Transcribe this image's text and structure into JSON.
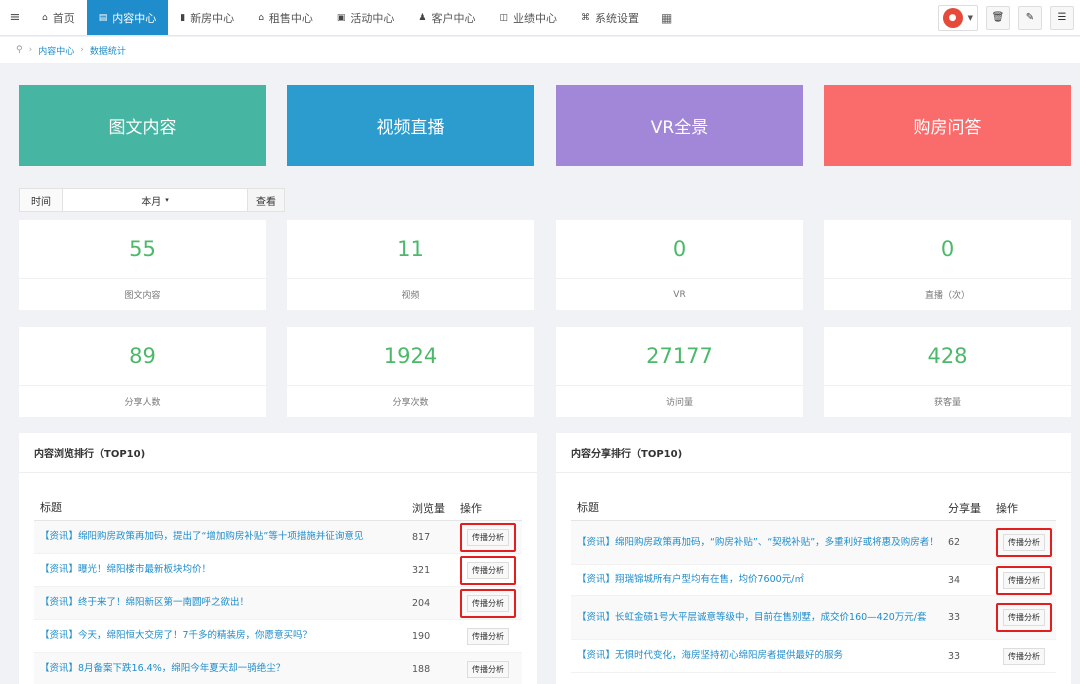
{
  "nav": {
    "items": [
      {
        "label": "首页",
        "icon": "home-icon",
        "glyph": "⌂"
      },
      {
        "label": "内容中心",
        "icon": "content-icon",
        "glyph": "▤",
        "active": true
      },
      {
        "label": "新房中心",
        "icon": "building-icon",
        "glyph": "▮"
      },
      {
        "label": "租售中心",
        "icon": "home-icon",
        "glyph": "⌂"
      },
      {
        "label": "活动中心",
        "icon": "calendar-icon",
        "glyph": "▣"
      },
      {
        "label": "客户中心",
        "icon": "user-add-icon",
        "glyph": "♟"
      },
      {
        "label": "业绩中心",
        "icon": "chart-icon",
        "glyph": "◫"
      },
      {
        "label": "系统设置",
        "icon": "settings-icon",
        "glyph": "⌘"
      }
    ],
    "active_color": "#1f8ccb"
  },
  "breadcrumb": {
    "items": [
      "内容中心",
      "数据统计"
    ]
  },
  "tiles": [
    {
      "label": "图文内容",
      "color": "#46b5a2"
    },
    {
      "label": "视频直播",
      "color": "#2c9ccf"
    },
    {
      "label": "VR全景",
      "color": "#a287d8"
    },
    {
      "label": "购房问答",
      "color": "#fa6b6b"
    }
  ],
  "filter": {
    "label": "时间",
    "value": "本月",
    "button": "查看"
  },
  "stats_row1": [
    {
      "value": "55",
      "label": "图文内容"
    },
    {
      "value": "11",
      "label": "视频"
    },
    {
      "value": "0",
      "label": "VR"
    },
    {
      "value": "0",
      "label": "直播（次）"
    }
  ],
  "stats_row2": [
    {
      "value": "89",
      "label": "分享人数"
    },
    {
      "value": "1924",
      "label": "分享次数"
    },
    {
      "value": "27177",
      "label": "访问量"
    },
    {
      "value": "428",
      "label": "获客量"
    }
  ],
  "browse_panel": {
    "title": "内容浏览排行（TOP10)",
    "headers": [
      "标题",
      "浏览量",
      "操作"
    ],
    "rows": [
      {
        "title": "【资讯】绵阳购房政策再加码，提出了“增加购房补贴”等十项措施并征询意见",
        "count": "817",
        "op": "传播分析",
        "highlight": true
      },
      {
        "title": "【资讯】曝光！绵阳楼市最新板块均价！",
        "count": "321",
        "op": "传播分析",
        "highlight": true
      },
      {
        "title": "【资讯】终于来了！绵阳新区第一南圆呼之欲出！",
        "count": "204",
        "op": "传播分析",
        "highlight": true
      },
      {
        "title": "【资讯】今天，绵阳恒大交房了！7千多的精装房，你愿意买吗？",
        "count": "190",
        "op": "传播分析",
        "highlight": false
      },
      {
        "title": "【资讯】8月备案下跌16.4%，绵阳今年夏天却一骑绝尘？",
        "count": "188",
        "op": "传播分析",
        "highlight": false
      }
    ]
  },
  "share_panel": {
    "title": "内容分享排行（TOP10)",
    "headers": [
      "标题",
      "分享量",
      "操作"
    ],
    "rows": [
      {
        "title": "【资讯】绵阳购房政策再加码，“购房补贴”、“契税补贴”，多重利好或将惠及购房者！",
        "count": "62",
        "op": "传播分析",
        "highlight": true
      },
      {
        "title": "【资讯】翔瑞锦城所有户型均有在售，均价7600元/㎡",
        "count": "34",
        "op": "传播分析",
        "highlight": true
      },
      {
        "title": "【资讯】长虹金碛1号大平层诚意等级中，目前在售别墅，成交价160—420万元/套",
        "count": "33",
        "op": "传播分析",
        "highlight": true
      },
      {
        "title": "【资讯】无惧时代变化，海房坚持初心绵阳房者提供最好的服务",
        "count": "33",
        "op": "传播分析",
        "highlight": false
      }
    ]
  }
}
